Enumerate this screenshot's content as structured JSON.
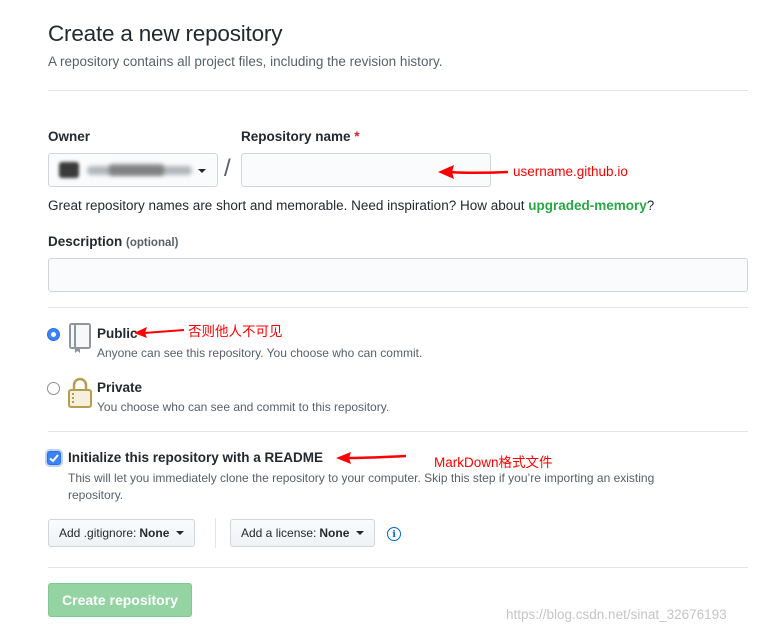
{
  "page": {
    "title": "Create a new repository",
    "subtitle": "A repository contains all project files, including the revision history."
  },
  "owner": {
    "label": "Owner"
  },
  "repo_name": {
    "label": "Repository name",
    "required_marker": "*",
    "value": "",
    "separator": "/"
  },
  "hint": {
    "text_before": "Great repository names are short and memorable. Need inspiration? How about ",
    "suggestion": "upgraded-memory",
    "text_after": "?"
  },
  "description": {
    "label": "Description",
    "optional": "(optional)",
    "value": ""
  },
  "visibility": {
    "selected": "public",
    "public": {
      "title": "Public",
      "note": "Anyone can see this repository. You choose who can commit."
    },
    "private": {
      "title": "Private",
      "note": "You choose who can see and commit to this repository."
    }
  },
  "readme": {
    "checked": true,
    "title": "Initialize this repository with a README",
    "note_line1": "This will let you immediately clone the repository to your computer. Skip this step if you’re importing an existing",
    "note_line2": "repository."
  },
  "gitignore": {
    "label": "Add .gitignore:",
    "value": "None"
  },
  "license": {
    "label": "Add a license:",
    "value": "None"
  },
  "icons": {
    "info": "info-icon",
    "public": "repo-book-icon",
    "private": "lock-icon"
  },
  "create_button": {
    "label": "Create repository"
  },
  "annotations": {
    "repo_name": "username.github.io",
    "public": "否则他人不可见",
    "readme": "MarkDown格式文件"
  },
  "watermark": "https://blog.csdn.net/sinat_32676193",
  "colors": {
    "accent_blue": "#0366d6",
    "suggestion_green": "#28a745",
    "annotation_red": "#ff0000",
    "create_button_disabled": "#94d3a2",
    "required_red": "#cb2431"
  }
}
